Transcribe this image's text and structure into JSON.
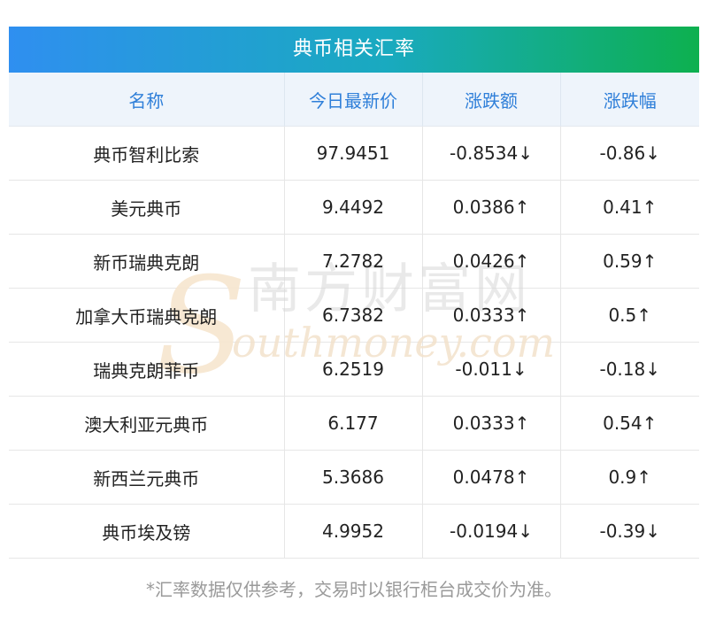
{
  "header": {
    "title": "典币相关汇率"
  },
  "table": {
    "columns": [
      "名称",
      "今日最新价",
      "涨跌额",
      "涨跌幅"
    ],
    "rows": [
      {
        "name": "典币智利比索",
        "price": "97.9451",
        "change": "-0.8534↓",
        "percent": "-0.86↓",
        "direction": "down"
      },
      {
        "name": "美元典币",
        "price": "9.4492",
        "change": "0.0386↑",
        "percent": "0.41↑",
        "direction": "up"
      },
      {
        "name": "新币瑞典克朗",
        "price": "7.2782",
        "change": "0.0426↑",
        "percent": "0.59↑",
        "direction": "up"
      },
      {
        "name": "加拿大币瑞典克朗",
        "price": "6.7382",
        "change": "0.0333↑",
        "percent": "0.5↑",
        "direction": "up"
      },
      {
        "name": "瑞典克朗菲币",
        "price": "6.2519",
        "change": "-0.011↓",
        "percent": "-0.18↓",
        "direction": "down"
      },
      {
        "name": "澳大利亚元典币",
        "price": "6.177",
        "change": "0.0333↑",
        "percent": "0.54↑",
        "direction": "up"
      },
      {
        "name": "新西兰元典币",
        "price": "5.3686",
        "change": "0.0478↑",
        "percent": "0.9↑",
        "direction": "up"
      },
      {
        "name": "典币埃及镑",
        "price": "4.9952",
        "change": "-0.0194↓",
        "percent": "-0.39↓",
        "direction": "down"
      }
    ]
  },
  "footnote": "*汇率数据仅供参考，交易时以银行柜台成交价为准。",
  "watermark": {
    "cn": "南方财富网",
    "en": "outhmoney.com"
  },
  "colors": {
    "header_gradient_start": "#2f8ff0",
    "header_gradient_end": "#0db04f",
    "column_header_text": "#2f7fd9",
    "up": "#e01818",
    "down": "#1a8a1a"
  }
}
